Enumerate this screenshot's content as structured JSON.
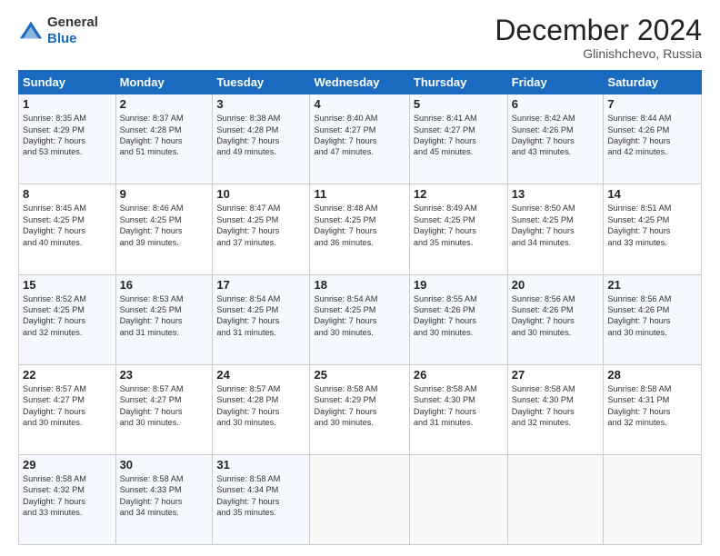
{
  "logo": {
    "general": "General",
    "blue": "Blue"
  },
  "header": {
    "month": "December 2024",
    "location": "Glinishchevo, Russia"
  },
  "weekdays": [
    "Sunday",
    "Monday",
    "Tuesday",
    "Wednesday",
    "Thursday",
    "Friday",
    "Saturday"
  ],
  "weeks": [
    [
      {
        "day": "1",
        "lines": [
          "Sunrise: 8:35 AM",
          "Sunset: 4:29 PM",
          "Daylight: 7 hours",
          "and 53 minutes."
        ]
      },
      {
        "day": "2",
        "lines": [
          "Sunrise: 8:37 AM",
          "Sunset: 4:28 PM",
          "Daylight: 7 hours",
          "and 51 minutes."
        ]
      },
      {
        "day": "3",
        "lines": [
          "Sunrise: 8:38 AM",
          "Sunset: 4:28 PM",
          "Daylight: 7 hours",
          "and 49 minutes."
        ]
      },
      {
        "day": "4",
        "lines": [
          "Sunrise: 8:40 AM",
          "Sunset: 4:27 PM",
          "Daylight: 7 hours",
          "and 47 minutes."
        ]
      },
      {
        "day": "5",
        "lines": [
          "Sunrise: 8:41 AM",
          "Sunset: 4:27 PM",
          "Daylight: 7 hours",
          "and 45 minutes."
        ]
      },
      {
        "day": "6",
        "lines": [
          "Sunrise: 8:42 AM",
          "Sunset: 4:26 PM",
          "Daylight: 7 hours",
          "and 43 minutes."
        ]
      },
      {
        "day": "7",
        "lines": [
          "Sunrise: 8:44 AM",
          "Sunset: 4:26 PM",
          "Daylight: 7 hours",
          "and 42 minutes."
        ]
      }
    ],
    [
      {
        "day": "8",
        "lines": [
          "Sunrise: 8:45 AM",
          "Sunset: 4:25 PM",
          "Daylight: 7 hours",
          "and 40 minutes."
        ]
      },
      {
        "day": "9",
        "lines": [
          "Sunrise: 8:46 AM",
          "Sunset: 4:25 PM",
          "Daylight: 7 hours",
          "and 39 minutes."
        ]
      },
      {
        "day": "10",
        "lines": [
          "Sunrise: 8:47 AM",
          "Sunset: 4:25 PM",
          "Daylight: 7 hours",
          "and 37 minutes."
        ]
      },
      {
        "day": "11",
        "lines": [
          "Sunrise: 8:48 AM",
          "Sunset: 4:25 PM",
          "Daylight: 7 hours",
          "and 36 minutes."
        ]
      },
      {
        "day": "12",
        "lines": [
          "Sunrise: 8:49 AM",
          "Sunset: 4:25 PM",
          "Daylight: 7 hours",
          "and 35 minutes."
        ]
      },
      {
        "day": "13",
        "lines": [
          "Sunrise: 8:50 AM",
          "Sunset: 4:25 PM",
          "Daylight: 7 hours",
          "and 34 minutes."
        ]
      },
      {
        "day": "14",
        "lines": [
          "Sunrise: 8:51 AM",
          "Sunset: 4:25 PM",
          "Daylight: 7 hours",
          "and 33 minutes."
        ]
      }
    ],
    [
      {
        "day": "15",
        "lines": [
          "Sunrise: 8:52 AM",
          "Sunset: 4:25 PM",
          "Daylight: 7 hours",
          "and 32 minutes."
        ]
      },
      {
        "day": "16",
        "lines": [
          "Sunrise: 8:53 AM",
          "Sunset: 4:25 PM",
          "Daylight: 7 hours",
          "and 31 minutes."
        ]
      },
      {
        "day": "17",
        "lines": [
          "Sunrise: 8:54 AM",
          "Sunset: 4:25 PM",
          "Daylight: 7 hours",
          "and 31 minutes."
        ]
      },
      {
        "day": "18",
        "lines": [
          "Sunrise: 8:54 AM",
          "Sunset: 4:25 PM",
          "Daylight: 7 hours",
          "and 30 minutes."
        ]
      },
      {
        "day": "19",
        "lines": [
          "Sunrise: 8:55 AM",
          "Sunset: 4:26 PM",
          "Daylight: 7 hours",
          "and 30 minutes."
        ]
      },
      {
        "day": "20",
        "lines": [
          "Sunrise: 8:56 AM",
          "Sunset: 4:26 PM",
          "Daylight: 7 hours",
          "and 30 minutes."
        ]
      },
      {
        "day": "21",
        "lines": [
          "Sunrise: 8:56 AM",
          "Sunset: 4:26 PM",
          "Daylight: 7 hours",
          "and 30 minutes."
        ]
      }
    ],
    [
      {
        "day": "22",
        "lines": [
          "Sunrise: 8:57 AM",
          "Sunset: 4:27 PM",
          "Daylight: 7 hours",
          "and 30 minutes."
        ]
      },
      {
        "day": "23",
        "lines": [
          "Sunrise: 8:57 AM",
          "Sunset: 4:27 PM",
          "Daylight: 7 hours",
          "and 30 minutes."
        ]
      },
      {
        "day": "24",
        "lines": [
          "Sunrise: 8:57 AM",
          "Sunset: 4:28 PM",
          "Daylight: 7 hours",
          "and 30 minutes."
        ]
      },
      {
        "day": "25",
        "lines": [
          "Sunrise: 8:58 AM",
          "Sunset: 4:29 PM",
          "Daylight: 7 hours",
          "and 30 minutes."
        ]
      },
      {
        "day": "26",
        "lines": [
          "Sunrise: 8:58 AM",
          "Sunset: 4:30 PM",
          "Daylight: 7 hours",
          "and 31 minutes."
        ]
      },
      {
        "day": "27",
        "lines": [
          "Sunrise: 8:58 AM",
          "Sunset: 4:30 PM",
          "Daylight: 7 hours",
          "and 32 minutes."
        ]
      },
      {
        "day": "28",
        "lines": [
          "Sunrise: 8:58 AM",
          "Sunset: 4:31 PM",
          "Daylight: 7 hours",
          "and 32 minutes."
        ]
      }
    ],
    [
      {
        "day": "29",
        "lines": [
          "Sunrise: 8:58 AM",
          "Sunset: 4:32 PM",
          "Daylight: 7 hours",
          "and 33 minutes."
        ]
      },
      {
        "day": "30",
        "lines": [
          "Sunrise: 8:58 AM",
          "Sunset: 4:33 PM",
          "Daylight: 7 hours",
          "and 34 minutes."
        ]
      },
      {
        "day": "31",
        "lines": [
          "Sunrise: 8:58 AM",
          "Sunset: 4:34 PM",
          "Daylight: 7 hours",
          "and 35 minutes."
        ]
      },
      null,
      null,
      null,
      null
    ]
  ]
}
